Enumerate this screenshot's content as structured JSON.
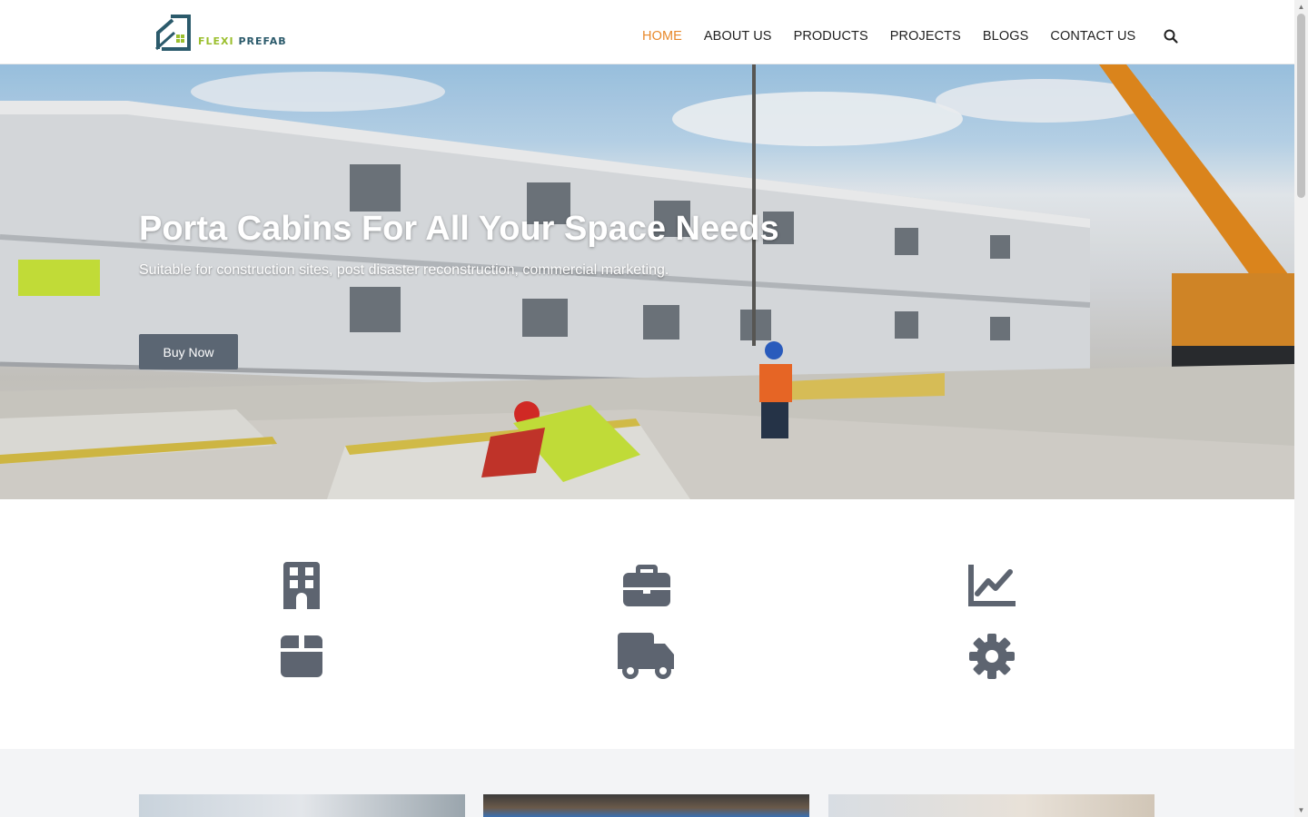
{
  "logo": {
    "word1": "FLEXI",
    "word2": "PREFAB"
  },
  "nav": {
    "items": [
      {
        "label": "HOME",
        "active": true
      },
      {
        "label": "ABOUT US",
        "active": false
      },
      {
        "label": "PRODUCTS",
        "active": false
      },
      {
        "label": "PROJECTS",
        "active": false
      },
      {
        "label": "BLOGS",
        "active": false
      },
      {
        "label": "CONTACT US",
        "active": false
      }
    ],
    "search_icon": "search-icon"
  },
  "hero": {
    "title": "Porta Cabins For All Your Space Needs",
    "subtitle": "Suitable for construction sites, post disaster reconstruction, commercial marketing.",
    "button": "Buy Now"
  },
  "features": {
    "icons": [
      "building-icon",
      "briefcase-icon",
      "chart-line-icon",
      "box-icon",
      "truck-icon",
      "gear-icon"
    ]
  },
  "colors": {
    "accent": "#e8892b",
    "button": "#5b6673",
    "icon": "#5d6470",
    "logo_green": "#9bbf2e",
    "logo_teal": "#2b5a6b"
  }
}
